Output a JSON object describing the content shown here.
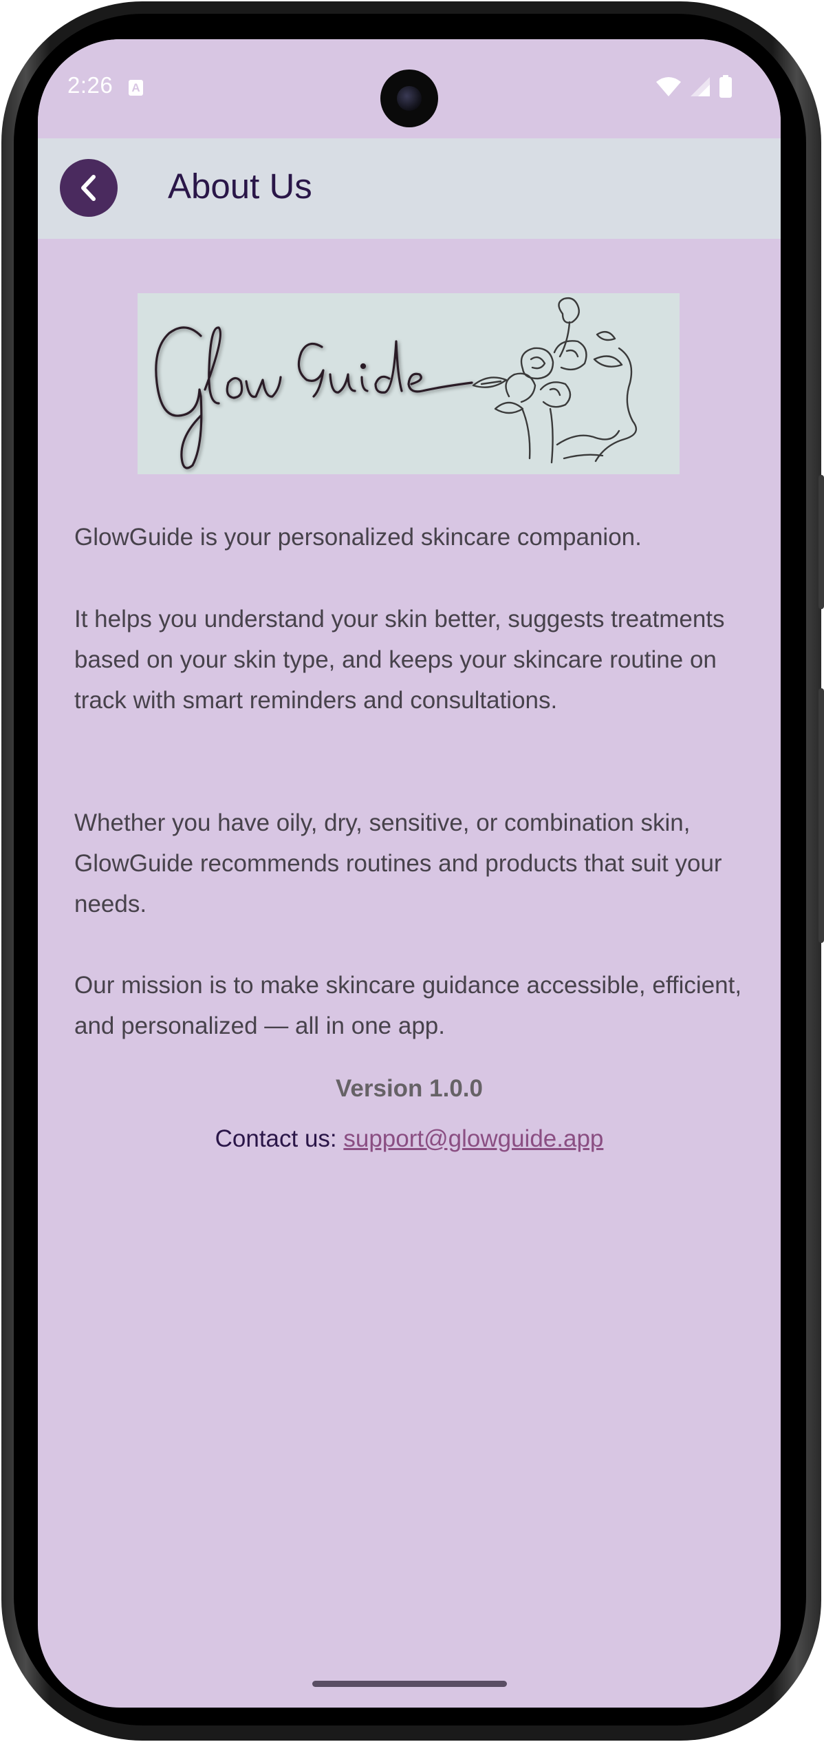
{
  "status_bar": {
    "time": "2:26",
    "notification_glyph": "A",
    "icons": [
      "wifi-icon",
      "signal-icon",
      "battery-icon"
    ]
  },
  "app_bar": {
    "title": "About Us",
    "back_icon": "chevron-left-icon"
  },
  "logo": {
    "brand": "GlowGuide",
    "illustration": "rose-flowers-line-art"
  },
  "content": {
    "paragraph_1": "GlowGuide is your personalized skincare companion.",
    "paragraph_2": "It helps you understand your skin better, suggests treatments based on your skin type, and keeps your skincare routine on track with smart reminders and consultations.",
    "paragraph_3": "Whether you have oily, dry, sensitive, or combination skin, GlowGuide recommends routines and products that suit your needs.",
    "paragraph_4": "Our mission is to make skincare guidance accessible, efficient, and personalized — all in one app."
  },
  "footer": {
    "version": "Version 1.0.0",
    "contact_label": "Contact us: ",
    "contact_email": "support@glowguide.app"
  },
  "colors": {
    "background": "#d8c6e3",
    "app_bar": "#d8dde4",
    "accent": "#4a2a5e",
    "title": "#2a1648",
    "link": "#8a4e82"
  }
}
